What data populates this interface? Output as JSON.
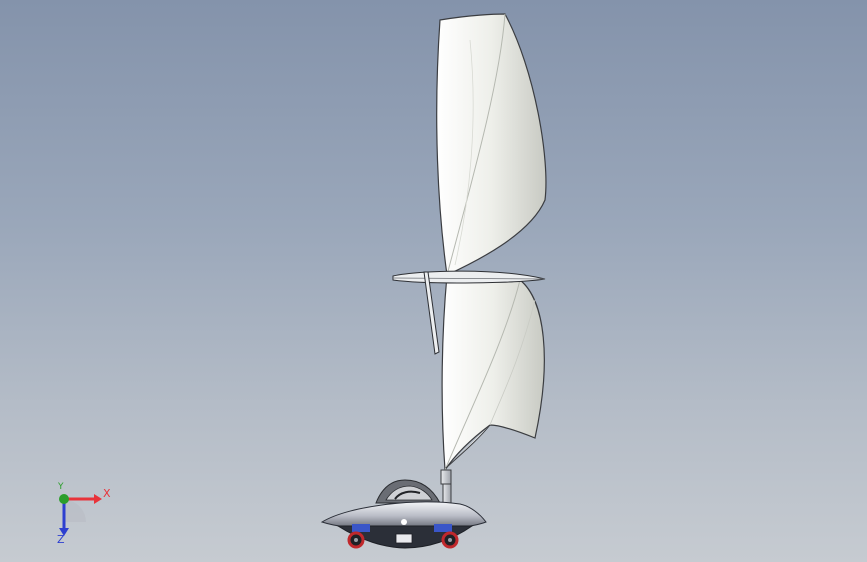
{
  "viewport": {
    "background_top": "#8493ab",
    "background_bottom": "#c6cbd1"
  },
  "model": {
    "sail_color": "#f3f4ef",
    "sail_shadow": "#c9cbc4",
    "hull_color": "#d6d8de",
    "hull_dark": "#2b2f38",
    "wheel_color": "#c0282c",
    "accent_blue": "#3a56c8"
  },
  "triad": {
    "x_label": "X",
    "y_label": "Y",
    "z_label": "Z",
    "x_color": "#e8333a",
    "y_color": "#2b9e2b",
    "z_color": "#2d3fd0"
  }
}
